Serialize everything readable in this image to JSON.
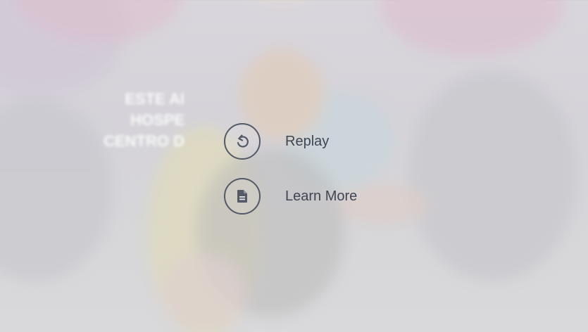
{
  "overlay": {
    "corner_text": "",
    "headline_lines": [
      "ESTE AI",
      "HOSPE",
      "CENTRO D"
    ]
  },
  "menu": {
    "replay": {
      "label": "Replay",
      "icon": "replay-icon"
    },
    "learn_more": {
      "label": "Learn More",
      "icon": "document-icon"
    }
  },
  "colors": {
    "icon_stroke": "#545a66",
    "label_text": "#3f4552"
  }
}
